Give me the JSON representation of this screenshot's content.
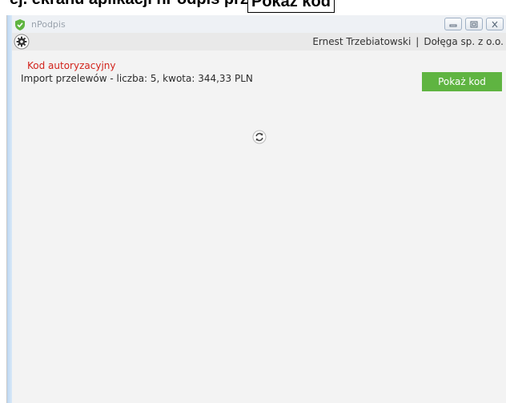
{
  "document": {
    "cropped_text": "ej. ekranu aplikacji nPodpis przycisk „",
    "highlighted_label": "Pokaż kod"
  },
  "window": {
    "title": "nPodpis",
    "controls": [
      "minimize",
      "maximize",
      "close"
    ],
    "accent_color": "#5fb441"
  },
  "header": {
    "user_name": "Ernest Trzebiatowski",
    "separator": "|",
    "company": "Dołęga sp. z o.o."
  },
  "main": {
    "section_title": "Kod autoryzacyjny",
    "import_summary": "Import przelewów - liczba: 5, kwota: 344,33 PLN",
    "show_code_button": "Pokaż kod",
    "status_icon": "refresh-icon"
  },
  "colors": {
    "title_red": "#d2231b",
    "button_green": "#5fb441"
  }
}
